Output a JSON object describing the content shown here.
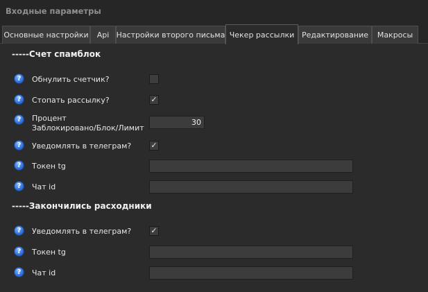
{
  "window": {
    "title": "Входные параметры"
  },
  "tabs": [
    {
      "label": "Основные настройки",
      "active": false
    },
    {
      "label": "Api",
      "active": false
    },
    {
      "label": "Настройки второго письма",
      "active": false
    },
    {
      "label": "Чекер рассылки",
      "active": true
    },
    {
      "label": "Редактирование",
      "active": false
    },
    {
      "label": "Макросы",
      "active": false
    }
  ],
  "sections": {
    "spamblock": {
      "title": "-----Счет спамблок",
      "reset_counter": {
        "label": "Обнулить счетчик?",
        "checked": false
      },
      "stop_mailing": {
        "label": "Стопать рассылку?",
        "checked": true
      },
      "percent": {
        "label_line1": "Процент",
        "label_line2": "Заблокировано/Блок/Лимит",
        "value": "30"
      },
      "notify_telegram": {
        "label": "Уведомлять в телеграм?",
        "checked": true
      },
      "token": {
        "label": "Токен tg",
        "value": ""
      },
      "chat": {
        "label": "Чат id",
        "value": ""
      }
    },
    "consumables": {
      "title": "-----Закончились расходники",
      "notify_telegram": {
        "label": "Уведомлять в телеграм?",
        "checked": true
      },
      "token": {
        "label": "Токен tg",
        "value": ""
      },
      "chat": {
        "label": "Чат id",
        "value": ""
      }
    }
  },
  "help_icon_glyph": "?",
  "check_glyph": "✓"
}
